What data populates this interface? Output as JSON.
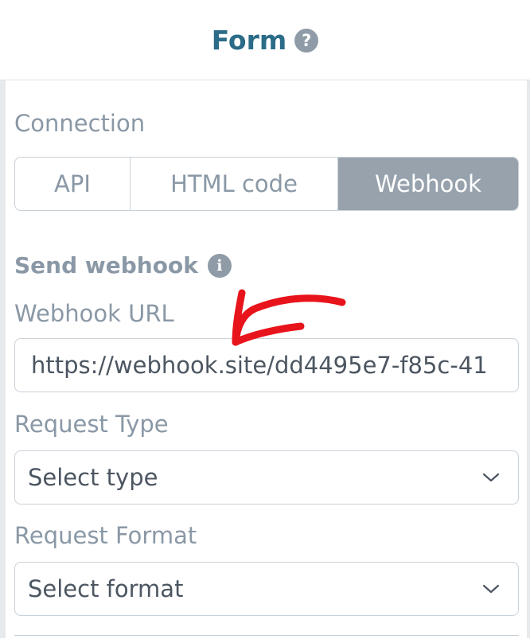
{
  "header": {
    "title": "Form",
    "help_icon": "?"
  },
  "connection": {
    "label": "Connection",
    "tabs": [
      {
        "label": "API",
        "active": false
      },
      {
        "label": "HTML code",
        "active": false
      },
      {
        "label": "Webhook",
        "active": true
      }
    ]
  },
  "webhook": {
    "section_label": "Send webhook",
    "info_icon": "i",
    "url_label": "Webhook URL",
    "url_value": "https://webhook.site/dd4495e7-f85c-41"
  },
  "request_type": {
    "label": "Request Type",
    "value": "Select type"
  },
  "request_format": {
    "label": "Request Format",
    "value": "Select format"
  },
  "colors": {
    "title": "#2b6c88",
    "muted": "#8a98a6",
    "active_tab_bg": "#97a2ad",
    "annotation_arrow": "#e8141b"
  },
  "icons": {
    "help": "question-circle-icon",
    "info": "info-circle-icon",
    "chevron": "chevron-down-icon",
    "annotation": "red-arrow-annotation"
  }
}
